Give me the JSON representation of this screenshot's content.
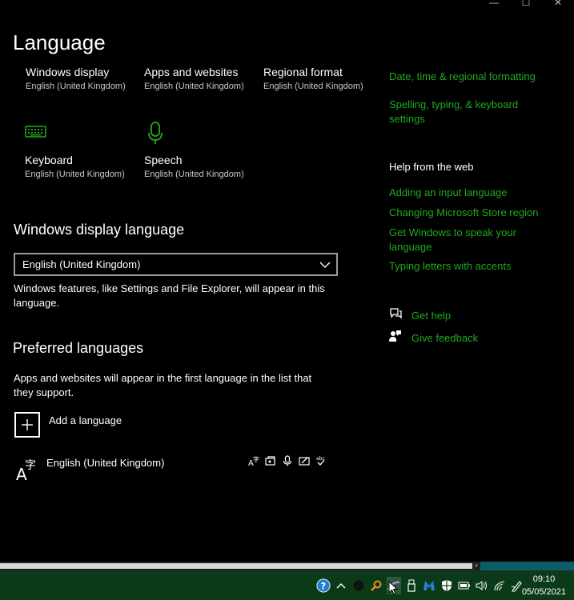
{
  "page": {
    "title": "Language"
  },
  "window_controls": {
    "minimize": "—",
    "maximize": "☐",
    "close": "✕"
  },
  "overview": [
    {
      "title": "Windows display",
      "subtitle": "English (United Kingdom)"
    },
    {
      "title": "Apps and websites",
      "subtitle": "English (United Kingdom)"
    },
    {
      "title": "Regional format",
      "subtitle": "English (United Kingdom)"
    },
    {
      "title": "Keyboard",
      "subtitle": "English (United Kingdom)",
      "icon": "keyboard-icon"
    },
    {
      "title": "Speech",
      "subtitle": "English (United Kingdom)",
      "icon": "microphone-icon"
    }
  ],
  "display_language": {
    "heading": "Windows display language",
    "selected": "English (United Kingdom)",
    "description": "Windows features, like Settings and File Explorer, will appear in this language."
  },
  "preferred": {
    "heading": "Preferred languages",
    "description": "Apps and websites will appear in the first language in the list that they support.",
    "add_label": "Add a language",
    "languages": [
      {
        "name": "English (United Kingdom)",
        "features": [
          "display-language-icon",
          "text-to-speech-icon",
          "speech-recognition-icon",
          "handwriting-icon",
          "spell-check-icon"
        ]
      }
    ]
  },
  "related": {
    "links": [
      "Date, time & regional formatting",
      "Spelling, typing, & keyboard settings"
    ]
  },
  "help_web": {
    "heading": "Help from the web",
    "links": [
      "Adding an input language",
      "Changing Microsoft Store region",
      "Get Windows to speak your language",
      "Typing letters with accents"
    ]
  },
  "support": {
    "get_help": "Get help",
    "give_feedback": "Give feedback"
  },
  "taskbar": {
    "time": "09:10",
    "date": "05/05/2021",
    "tray_icons": [
      "help-icon",
      "chevron-up-icon",
      "circle-icon",
      "search-app-icon",
      "pen-app-icon",
      "usb-icon",
      "malwarebytes-icon",
      "shield-icon",
      "battery-icon",
      "volume-icon",
      "wifi-icon",
      "pen-ink-icon"
    ]
  },
  "colors": {
    "accent": "#21a821",
    "background": "#000000",
    "taskbar": "#0b3a18"
  }
}
